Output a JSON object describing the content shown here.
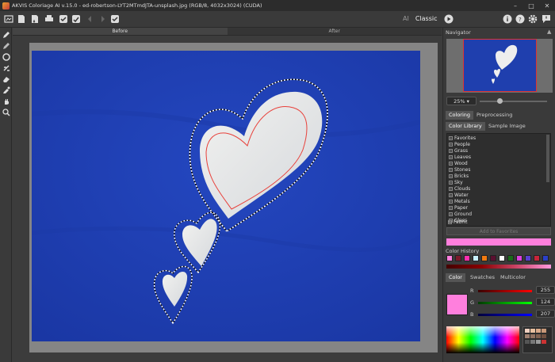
{
  "titlebar": {
    "title": "AKVIS Coloriage AI v.15.0 - ed-robertson-LYT2MTmdJTA-unsplash.jpg (RGB/8, 4032x3024) (CUDA)",
    "minimize": "–",
    "maximize": "□",
    "close": "✕"
  },
  "toolbar": {
    "mode_ai": "AI",
    "mode_classic": "Classic"
  },
  "canvas_tabs": {
    "before": "Before",
    "after": "After"
  },
  "panel": {
    "navigator_label": "Navigator",
    "zoom_value": "25%",
    "tab_coloring": "Coloring",
    "tab_preprocessing": "Preprocessing",
    "tab_color_library": "Color Library",
    "tab_sample_image": "Sample Image",
    "library_items": [
      "Favorites",
      "People",
      "Grass",
      "Leaves",
      "Wood",
      "Stones",
      "Bricks",
      "Sky",
      "Clouds",
      "Water",
      "Metals",
      "Paper",
      "Ground",
      "Glass",
      "Fabric"
    ],
    "add_to_favorites": "Add to Favorites",
    "color_history_label": "Color History",
    "history_colors": [
      "#ff7fdd",
      "#7a1a2a",
      "#ff2fae",
      "#c8f0ff",
      "#f07a10",
      "#5a1030",
      "#ffffff",
      "#1a6a1a",
      "#e040e0",
      "#5a3fd0",
      "#c8243a",
      "#2a3fc8"
    ],
    "tab_color": "Color",
    "tab_swatches": "Swatches",
    "tab_multicolor": "Multicolor",
    "current_color": "#ff7fdd",
    "r_label": "R",
    "g_label": "G",
    "b_label": "B",
    "r_value": "255",
    "g_value": "124",
    "b_value": "207"
  },
  "colors": {
    "accent": "#ff7fdd",
    "photo_bg": "#1f3fae",
    "stroke": "#e8403a"
  }
}
